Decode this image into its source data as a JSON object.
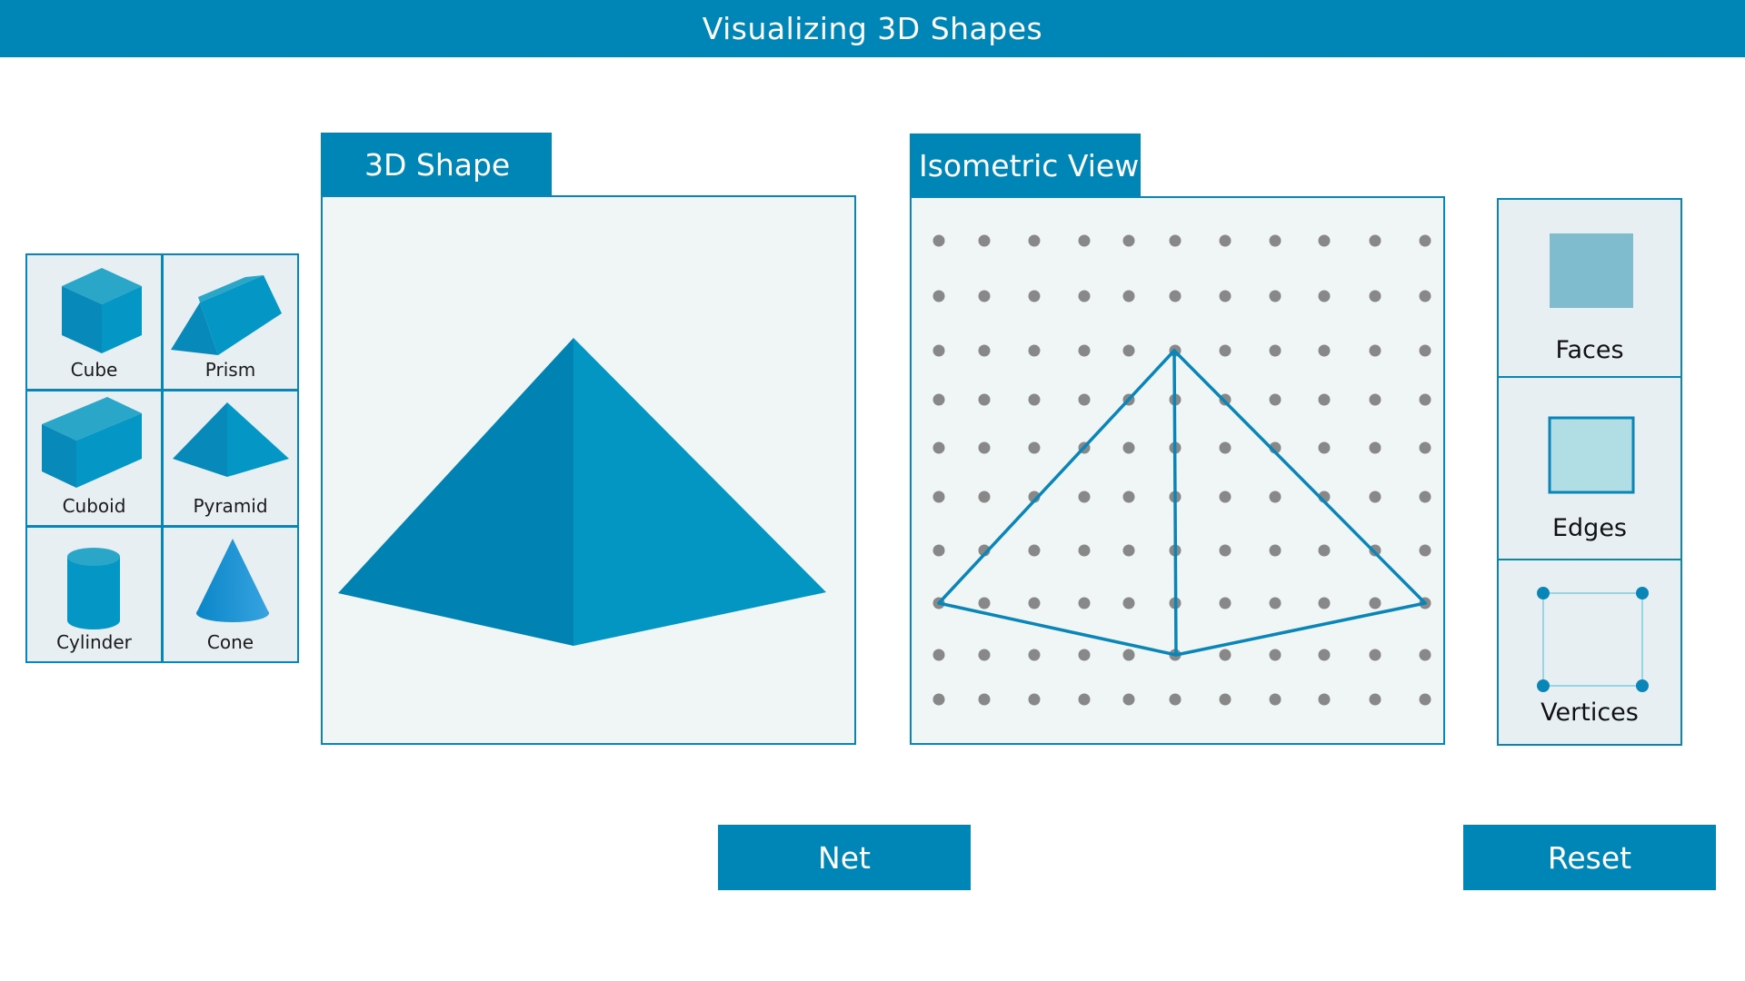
{
  "header": {
    "title": "Visualizing 3D Shapes"
  },
  "palette": {
    "items": [
      {
        "id": "cube",
        "label": "Cube"
      },
      {
        "id": "prism",
        "label": "Prism"
      },
      {
        "id": "cuboid",
        "label": "Cuboid"
      },
      {
        "id": "pyramid",
        "label": "Pyramid"
      },
      {
        "id": "cylinder",
        "label": "Cylinder"
      },
      {
        "id": "cone",
        "label": "Cone"
      }
    ]
  },
  "panels": {
    "shape_tab": "3D Shape",
    "iso_tab": "Isometric View",
    "selected_shape": "pyramid"
  },
  "properties": {
    "faces": "Faces",
    "edges": "Edges",
    "vertices": "Vertices"
  },
  "buttons": {
    "net": "Net",
    "reset": "Reset"
  },
  "colors": {
    "accent": "#0086b6",
    "panel_border": "#0a85b7",
    "shape_dark": "#0083b3",
    "shape_light": "#0496c3",
    "dot": "#888888"
  }
}
